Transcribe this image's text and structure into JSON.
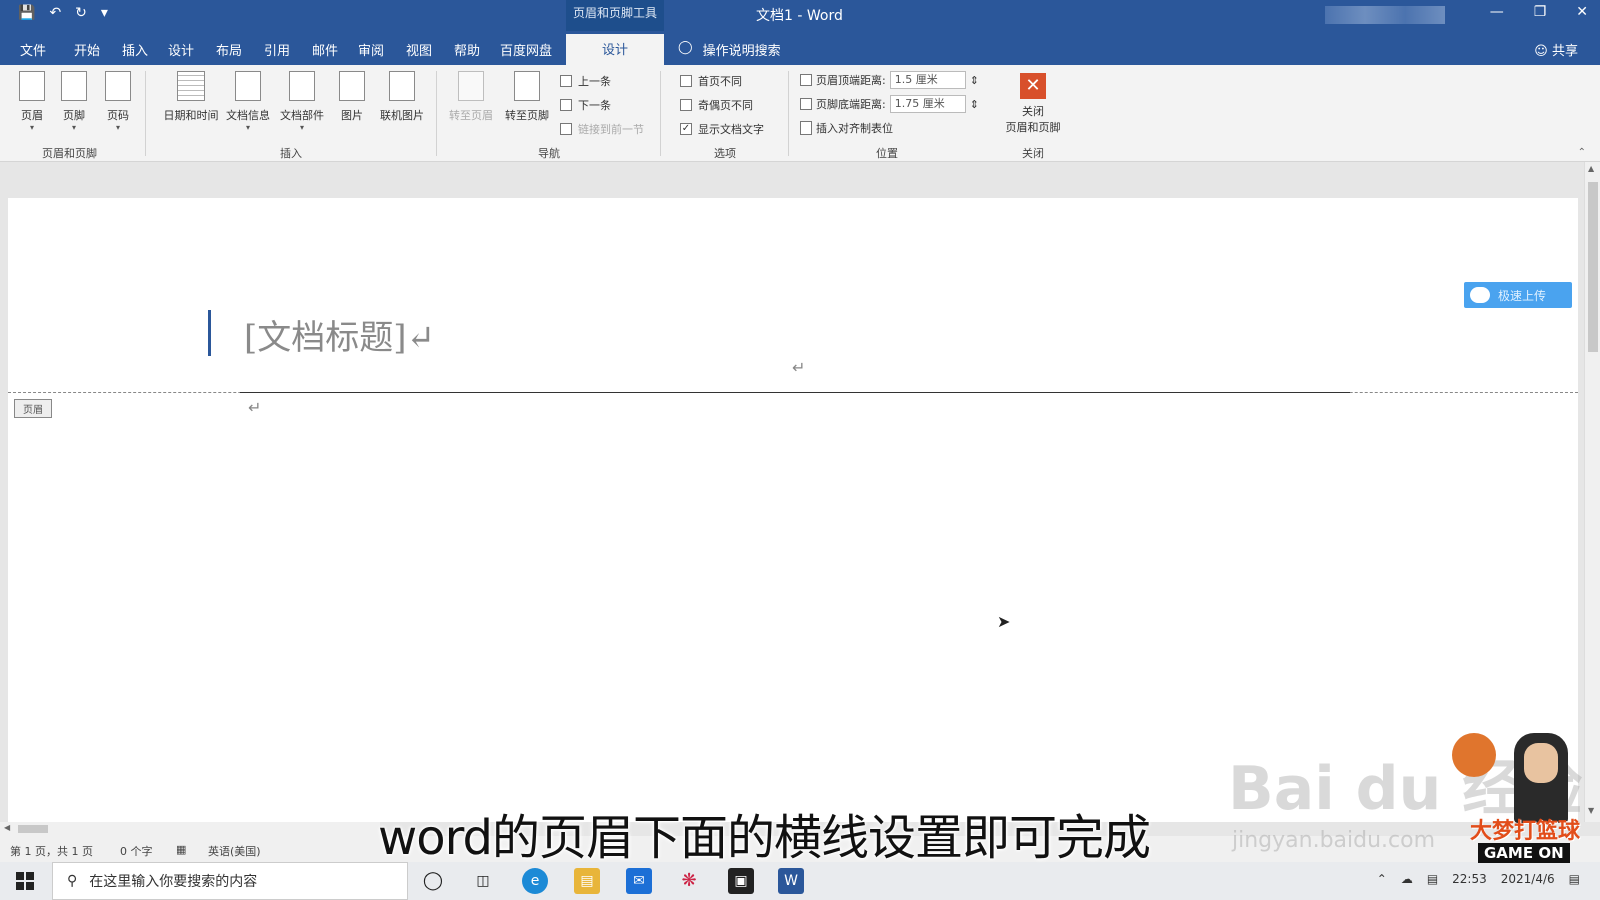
{
  "titlebar": {
    "context_tab": "页眉和页脚工具",
    "title": "文档1 - Word"
  },
  "tabs": [
    "文件",
    "开始",
    "插入",
    "设计",
    "布局",
    "引用",
    "邮件",
    "审阅",
    "视图",
    "帮助",
    "百度网盘",
    "设计"
  ],
  "tellme": "操作说明搜索",
  "share": "共享",
  "ribbon": {
    "group_header_footer": {
      "label": "页眉和页脚",
      "buttons": [
        "页眉",
        "页脚",
        "页码"
      ]
    },
    "group_insert": {
      "label": "插入",
      "buttons": [
        "日期和时间",
        "文档信息",
        "文档部件",
        "图片",
        "联机图片"
      ]
    },
    "group_nav": {
      "label": "导航",
      "buttons": [
        "转至页眉",
        "转至页脚"
      ],
      "items": [
        "上一条",
        "下一条",
        "链接到前一节"
      ]
    },
    "group_options": {
      "label": "选项",
      "items": [
        "首页不同",
        "奇偶页不同",
        "显示文档文字"
      ],
      "checked": [
        false,
        false,
        true
      ]
    },
    "group_position": {
      "label": "位置",
      "header_label": "页眉顶端距离:",
      "header_value": "1.5 厘米",
      "footer_label": "页脚底端距离:",
      "footer_value": "1.75 厘米",
      "insert_tab": "插入对齐制表位"
    },
    "group_close": {
      "label": "关闭",
      "button": "关闭\n页眉和页脚"
    }
  },
  "document": {
    "title_placeholder": "[文档标题]↵",
    "para_mark": "↵",
    "header_tag": "页眉",
    "upload_label": "极速上传"
  },
  "statusbar": {
    "page": "第 1 页，共 1 页",
    "words": "0 个字",
    "language": "英语(美国)"
  },
  "taskbar": {
    "search_placeholder": "在这里输入你要搜索的内容",
    "time": "22:53",
    "date": "2021/4/6"
  },
  "overlay": {
    "subtitle": "word的页眉下面的横线设置即可完成",
    "watermark": "Bai du 经验",
    "watermark_url": "jingyan.baidu.com",
    "brand": "大梦打篮球",
    "brand_sub": "GAME ON"
  },
  "colors": {
    "word_blue": "#2b579a",
    "close_red": "#d8502b",
    "upload_blue": "#4aa3ef"
  }
}
